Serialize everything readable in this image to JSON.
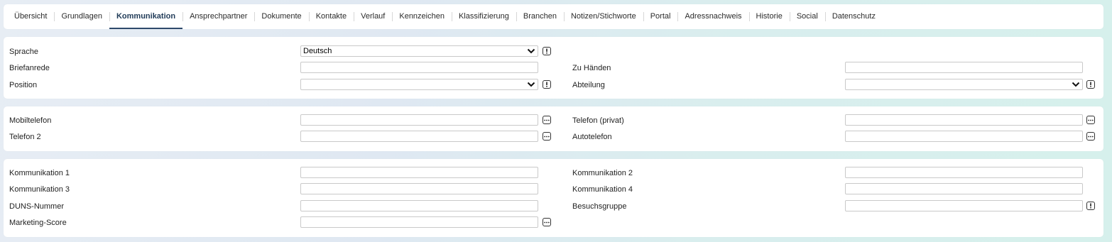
{
  "tabs": [
    {
      "label": "Übersicht"
    },
    {
      "label": "Grundlagen"
    },
    {
      "label": "Kommunikation"
    },
    {
      "label": "Ansprechpartner"
    },
    {
      "label": "Dokumente"
    },
    {
      "label": "Kontakte"
    },
    {
      "label": "Verlauf"
    },
    {
      "label": "Kennzeichen"
    },
    {
      "label": "Klassifizierung"
    },
    {
      "label": "Branchen"
    },
    {
      "label": "Notizen/Stichworte"
    },
    {
      "label": "Portal"
    },
    {
      "label": "Adressnachweis"
    },
    {
      "label": "Historie"
    },
    {
      "label": "Social"
    },
    {
      "label": "Datenschutz"
    }
  ],
  "active_tab": "Kommunikation",
  "general": {
    "sprache_label": "Sprache",
    "sprache_value": "Deutsch",
    "briefanrede_label": "Briefanrede",
    "briefanrede_value": "",
    "position_label": "Position",
    "position_value": "",
    "zu_haenden_label": "Zu Händen",
    "zu_haenden_value": "",
    "abteilung_label": "Abteilung",
    "abteilung_value": ""
  },
  "phones": {
    "mobiltelefon_label": "Mobiltelefon",
    "mobiltelefon_value": "",
    "telefon2_label": "Telefon 2",
    "telefon2_value": "",
    "telefon_privat_label": "Telefon (privat)",
    "telefon_privat_value": "",
    "autotelefon_label": "Autotelefon",
    "autotelefon_value": ""
  },
  "communication": {
    "kommunikation1_label": "Kommunikation 1",
    "kommunikation1_value": "",
    "kommunikation2_label": "Kommunikation 2",
    "kommunikation2_value": "",
    "kommunikation3_label": "Kommunikation 3",
    "kommunikation3_value": "",
    "kommunikation4_label": "Kommunikation 4",
    "kommunikation4_value": "",
    "duns_label": "DUNS-Nummer",
    "duns_value": "",
    "besuchsgruppe_label": "Besuchsgruppe",
    "besuchsgruppe_value": "",
    "marketing_score_label": "Marketing-Score",
    "marketing_score_value": ""
  },
  "icons": {
    "info": "exclamation-box-icon",
    "more": "ellipsis-box-icon",
    "dropdown": "chevron-down-icon"
  },
  "colors": {
    "active_tab": "#1f3a57",
    "panel": "#ffffff"
  }
}
